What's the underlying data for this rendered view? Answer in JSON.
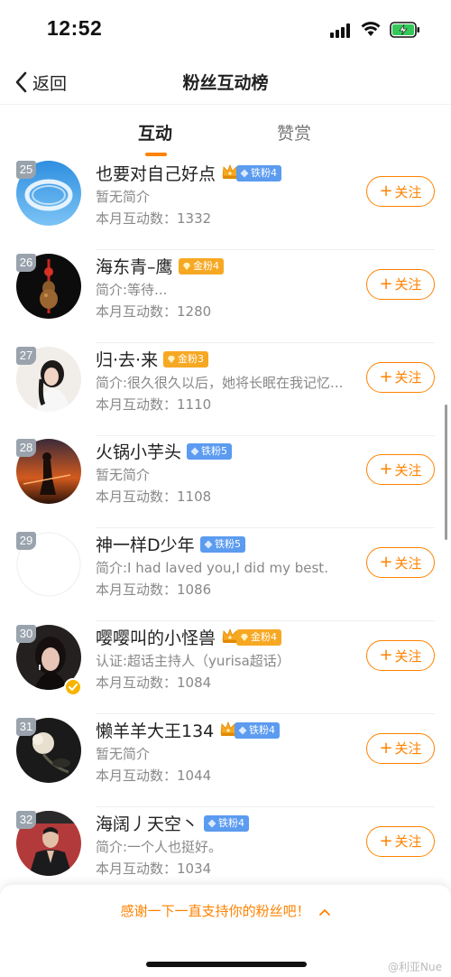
{
  "status_bar": {
    "time": "12:52"
  },
  "nav": {
    "back_label": "返回",
    "title": "粉丝互动榜"
  },
  "tabs": [
    {
      "label": "互动"
    },
    {
      "label": "赞赏"
    }
  ],
  "fans": [
    {
      "rank": "25",
      "name": "也要对自己好点",
      "level": "铁粉4",
      "level_type": "iron",
      "crown": true,
      "bio": "暂无简介",
      "count": "本月互动数：1332",
      "follow": "关注",
      "avatar": "sky-cloud"
    },
    {
      "rank": "26",
      "name": "海东青–鹰",
      "level": "金粉4",
      "level_type": "gold",
      "crown": false,
      "bio": "简介:等待...",
      "count": "本月互动数：1280",
      "follow": "关注",
      "avatar": "dark-ornament"
    },
    {
      "rank": "27",
      "name": "归·去·来",
      "level": "金粉3",
      "level_type": "gold",
      "crown": false,
      "bio": "简介:很久很久以后，她将长眠在我记忆...",
      "count": "本月互动数：1110",
      "follow": "关注",
      "avatar": "portrait-light"
    },
    {
      "rank": "28",
      "name": "火锅小芋头",
      "level": "铁粉5",
      "level_type": "iron",
      "crown": false,
      "bio": "暂无简介",
      "count": "本月互动数：1108",
      "follow": "关注",
      "avatar": "warrior-sunset"
    },
    {
      "rank": "29",
      "name": "神一样D少年",
      "level": "铁粉5",
      "level_type": "iron",
      "crown": false,
      "bio": "简介:I had laved you,I did my best.",
      "count": "本月互动数：1086",
      "follow": "关注",
      "avatar": "blank"
    },
    {
      "rank": "30",
      "name": "嘤嘤叫的小怪兽",
      "level": "金粉4",
      "level_type": "gold",
      "crown": true,
      "bio": "认证:超话主持人（yurisa超话）",
      "count": "本月互动数：1084",
      "follow": "关注",
      "avatar": "portrait-dark",
      "verified": true
    },
    {
      "rank": "31",
      "name": "懒羊羊大王134",
      "level": "铁粉4",
      "level_type": "iron",
      "crown": true,
      "bio": "暂无简介",
      "count": "本月互动数：1044",
      "follow": "关注",
      "avatar": "flower-dark"
    },
    {
      "rank": "32",
      "name": "海阔丿天空丶",
      "level": "铁粉4",
      "level_type": "iron",
      "crown": false,
      "bio": "简介:一个人也挺好。",
      "count": "本月互动数：1034",
      "follow": "关注",
      "avatar": "man-coat"
    }
  ],
  "footer": {
    "message": "感谢一下一直支持你的粉丝吧！",
    "watermark": "@利亚Nue"
  },
  "colors": {
    "accent": "#ff8200",
    "iron": "#5b9bf0",
    "gold": "#f7a823",
    "rank_badge": "#9aa3ad"
  }
}
